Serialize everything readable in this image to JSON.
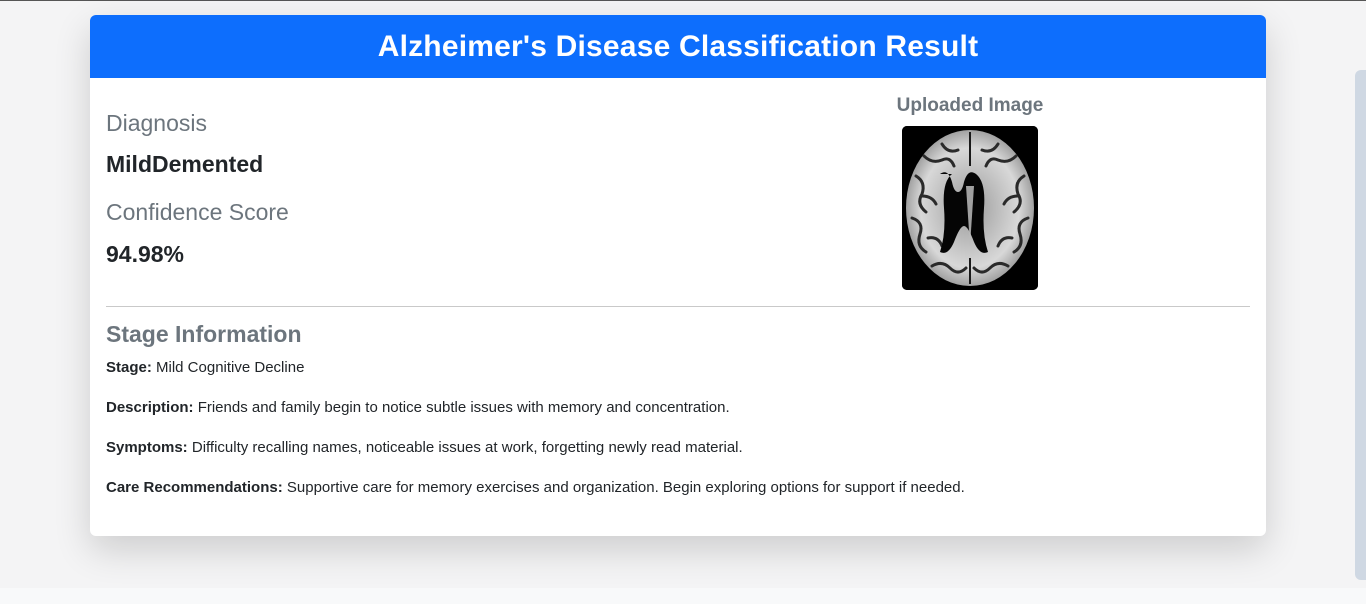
{
  "page": {
    "title": "Alzheimer's Disease Classification Result"
  },
  "diagnosis": {
    "heading": "Diagnosis",
    "value": "MildDemented"
  },
  "confidence": {
    "heading": "Confidence Score",
    "value": "94.98%"
  },
  "uploaded_image": {
    "heading": "Uploaded Image",
    "icon": "brain-mri-image"
  },
  "stage_info": {
    "heading": "Stage Information",
    "stage_label": "Stage:",
    "stage_value": "Mild Cognitive Decline",
    "description_label": "Description:",
    "description_value": "Friends and family begin to notice subtle issues with memory and concentration.",
    "symptoms_label": "Symptoms:",
    "symptoms_value": "Difficulty recalling names, noticeable issues at work, forgetting newly read material.",
    "care_label": "Care Recommendations:",
    "care_value": "Supportive care for memory exercises and organization. Begin exploring options for support if needed."
  },
  "colors": {
    "header_bg": "#0d6efd",
    "muted_text": "#6c757d",
    "body_text": "#212529"
  }
}
